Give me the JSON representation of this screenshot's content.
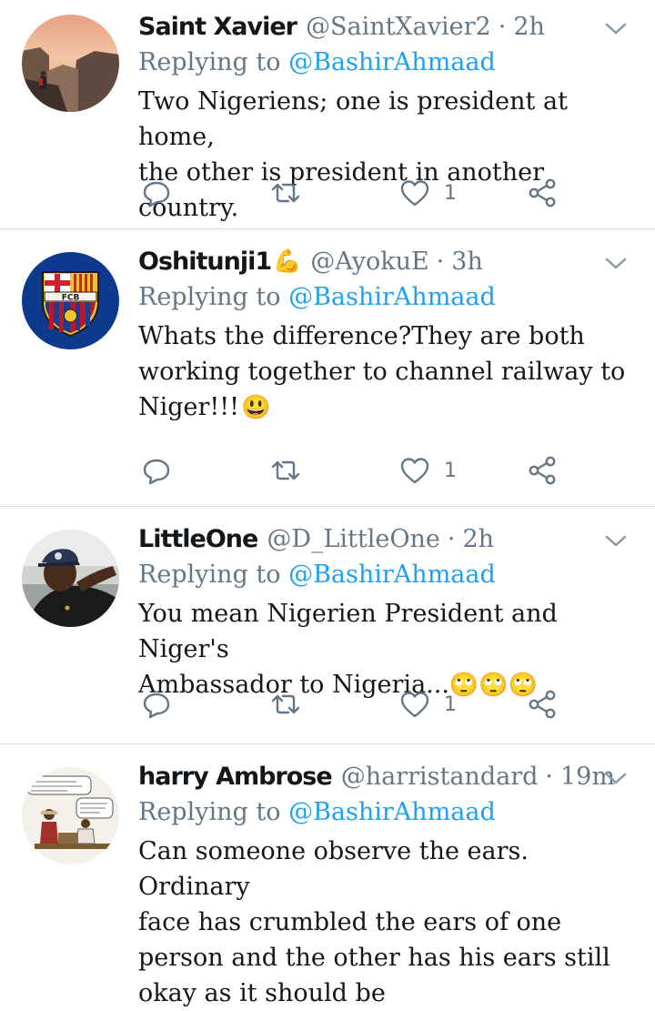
{
  "tweets": [
    {
      "name": "Saint Xavier",
      "handle": "@SaintXavier2",
      "sep": "·",
      "time": "2h",
      "replying_prefix": "Replying to",
      "replying_to": "@BashirAhmaad",
      "text_lines": [
        "Two Nigeriens; one is president at home,",
        "the other is president in another country."
      ],
      "likes": "1",
      "avatar": "canyon-hiker-photo"
    },
    {
      "name": "Oshitunji1",
      "name_emoji": "💪",
      "handle": "@AyokuE",
      "sep": "·",
      "time": "3h",
      "replying_prefix": "Replying to",
      "replying_to": "@BashirAhmaad",
      "text_lines": [
        "Whats the difference?They are both",
        "working together to channel railway to",
        "Niger!!!"
      ],
      "text_emoji": "😃",
      "likes": "1",
      "avatar": "fc-barcelona-crest",
      "crest_text": "FCB"
    },
    {
      "name": "LittleOne",
      "handle": "@D_LittleOne",
      "sep": "·",
      "time": "2h",
      "replying_prefix": "Replying to",
      "replying_to": "@BashirAhmaad",
      "text_lines": [
        "You mean Nigerien President and Niger's",
        "Ambassador to Nigeria..."
      ],
      "text_emoji": "🙄🙄🙄",
      "likes": "1",
      "avatar": "man-in-cap-photo"
    },
    {
      "name": "harry Ambrose",
      "handle": "@harristandard",
      "sep": "·",
      "time": "19m",
      "replying_prefix": "Replying to",
      "replying_to": "@BashirAhmaad",
      "text_lines": [
        "Can someone observe the ears. Ordinary",
        "face has crumbled the ears of one",
        "person and the other has his ears still",
        "okay as it should be"
      ],
      "avatar": "cartoon-illustration"
    }
  ],
  "colors": {
    "accent": "#1da1f2",
    "muted": "#657786",
    "text": "#14171a",
    "divider": "#d9dee2"
  }
}
